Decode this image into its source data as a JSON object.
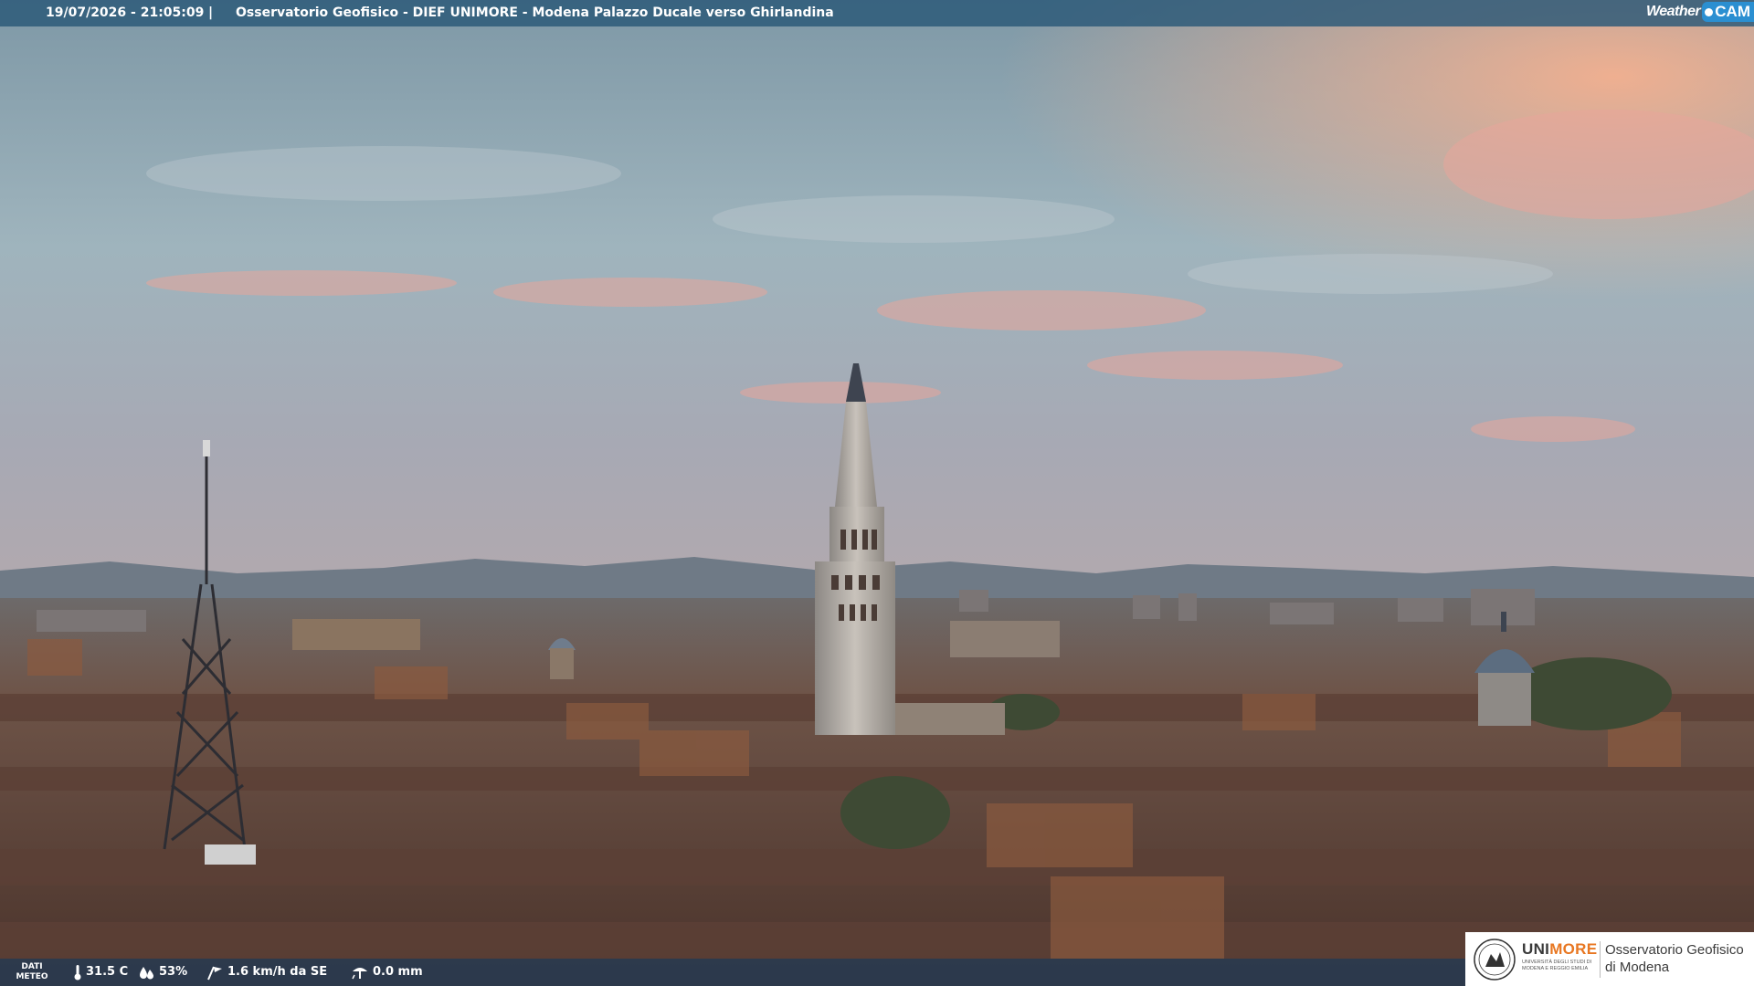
{
  "top_bar": {
    "timestamp": "19/07/2026 - 21:05:09",
    "separator": "|",
    "title": "Osservatorio Geofisico - DIEF UNIMORE - Modena Palazzo Ducale verso Ghirlandina"
  },
  "weathercam_logo": {
    "word": "Weather",
    "cam": "CAM"
  },
  "weather_strip": {
    "label": "DATI METEO",
    "temperature": "31.5 C",
    "humidity": "53%",
    "wind": "1.6 km/h da SE",
    "rain": "0.0 mm"
  },
  "unimore_logo": {
    "uni_part": "UNI",
    "more_part": "MORE",
    "university_line": "UNIVERSITÀ DEGLI STUDI DI MODENA E REGGIO EMILIA",
    "observatory_line1": "Osservatorio Geofisico",
    "observatory_line2": "di Modena"
  },
  "colors": {
    "top_bar": "#2a5878",
    "logo_blue": "#2b8fd1",
    "unimore_orange": "#e87722",
    "sky_pink": "#e8a59a",
    "roof_brown": "#6b4a3a"
  }
}
